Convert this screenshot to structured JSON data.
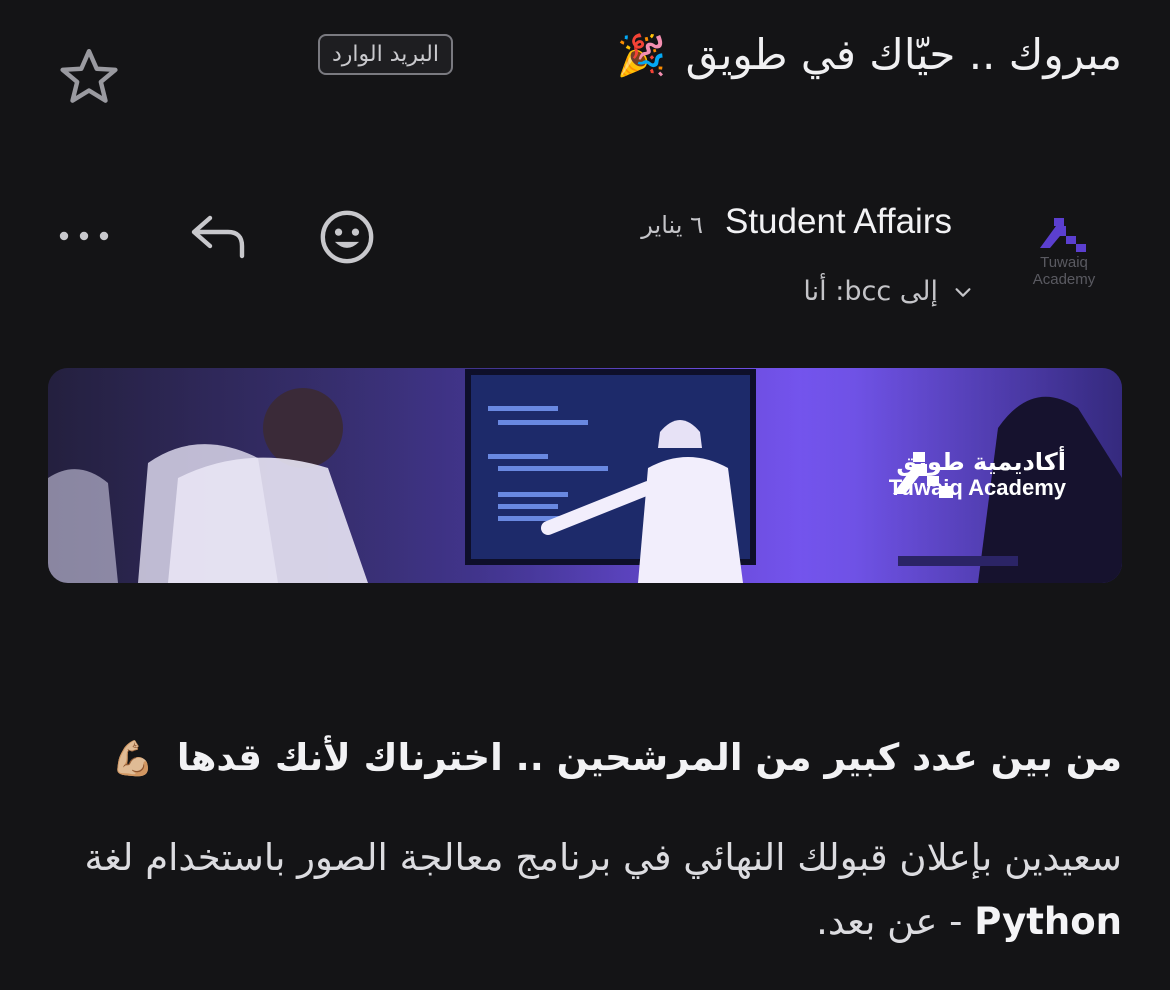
{
  "header": {
    "subject": "مبروك .. حيّاك في طويق",
    "subject_emoji": "🎉",
    "label": "البريد الوارد",
    "star_icon": "star-outline-icon"
  },
  "sender": {
    "name": "Student Affairs",
    "date": "٦ يناير",
    "recipients": "إلى bcc: أنا",
    "avatar_text_line1": "Tuwaiq",
    "avatar_text_line2": "Academy"
  },
  "actions": {
    "react_icon": "smiley-icon",
    "reply_icon": "reply-icon",
    "more_icon": "more-horizontal-icon"
  },
  "banner": {
    "brand_ar": "أكاديمية طويق",
    "brand_en": "Tuwaiq Academy"
  },
  "message": {
    "headline": "من بين عدد كبير من المرشحين .. اخترناك لأنك قدها",
    "headline_emoji": "💪🏼",
    "body_part1": "سعيدين بإعلان قبولك النهائي في برنامج معالجة الصور باستخدام لغة",
    "body_bold": "Python",
    "body_part2": "- عن بعد."
  },
  "colors": {
    "background": "#141416",
    "brand_purple": "#6f52e6"
  }
}
